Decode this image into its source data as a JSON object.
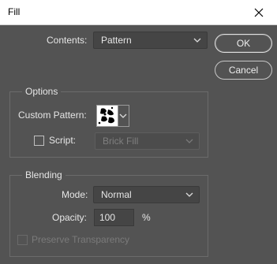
{
  "window": {
    "title": "Fill",
    "close_icon": "close-icon"
  },
  "contents": {
    "label": "Contents:",
    "value": "Pattern"
  },
  "buttons": {
    "ok": "OK",
    "cancel": "Cancel"
  },
  "options": {
    "group_label": "Options",
    "custom_pattern_label": "Custom Pattern:",
    "script_label": "Script:",
    "script_checked": false,
    "script_value": "Brick Fill"
  },
  "blending": {
    "group_label": "Blending",
    "mode_label": "Mode:",
    "mode_value": "Normal",
    "opacity_label": "Opacity:",
    "opacity_value": "100",
    "opacity_unit": "%",
    "preserve_label": "Preserve Transparency",
    "preserve_checked": false
  },
  "colors": {
    "panel_bg": "#535353",
    "title_bg": "#ffffff",
    "text": "#e6e6e6"
  }
}
